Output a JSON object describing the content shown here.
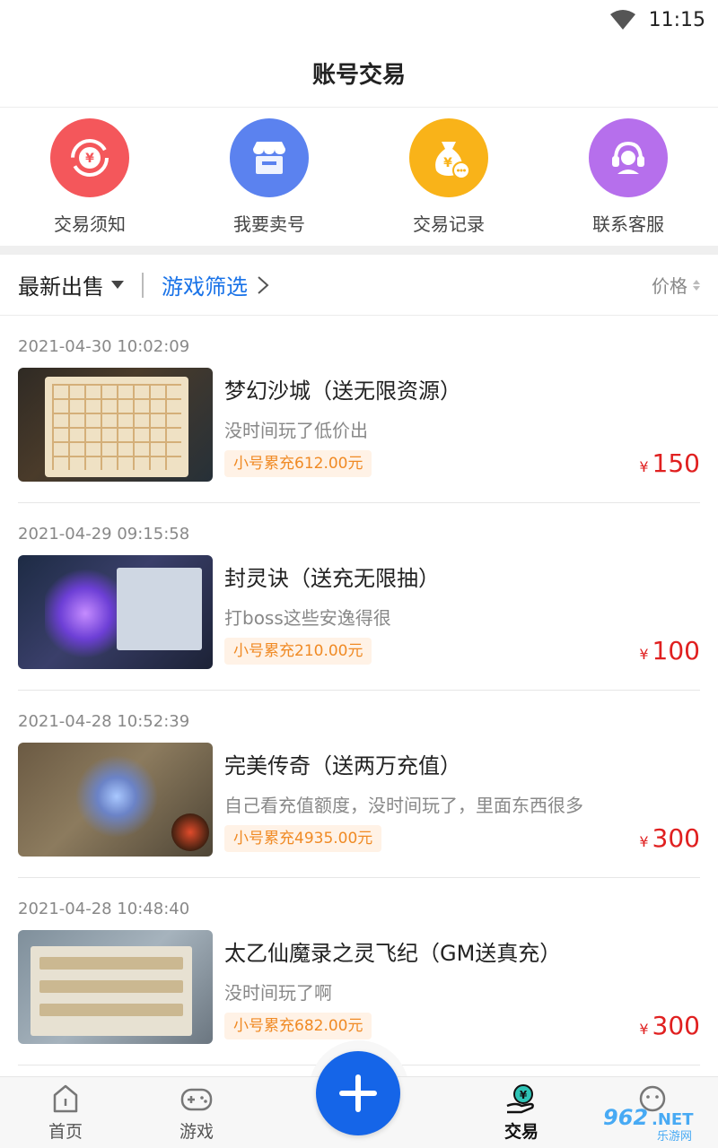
{
  "status_bar": {
    "time": "11:15"
  },
  "header": {
    "title": "账号交易"
  },
  "quick_actions": [
    {
      "label": "交易须知",
      "icon": "yuan-exchange-icon",
      "color": "#f4575b"
    },
    {
      "label": "我要卖号",
      "icon": "shop-icon",
      "color": "#5b82ef"
    },
    {
      "label": "交易记录",
      "icon": "money-bag-icon",
      "color": "#f9b319"
    },
    {
      "label": "联系客服",
      "icon": "headset-icon",
      "color": "#b66fec"
    }
  ],
  "filter_bar": {
    "sort_label": "最新出售",
    "game_filter": "游戏筛选",
    "price_label": "价格"
  },
  "listings": [
    {
      "date": "2021-04-30 10:02:09",
      "title": "梦幻沙城（送无限资源）",
      "desc": "没时间玩了低价出",
      "tag": "小号累充612.00元",
      "currency": "¥",
      "price": "150"
    },
    {
      "date": "2021-04-29 09:15:58",
      "title": "封灵诀（送充无限抽）",
      "desc": "打boss这些安逸得很",
      "tag": "小号累充210.00元",
      "currency": "¥",
      "price": "100"
    },
    {
      "date": "2021-04-28 10:52:39",
      "title": "完美传奇（送两万充值）",
      "desc": "自己看充值额度，没时间玩了，里面东西很多",
      "tag": "小号累充4935.00元",
      "currency": "¥",
      "price": "300"
    },
    {
      "date": "2021-04-28 10:48:40",
      "title": "太乙仙魔录之灵飞纪（GM送真充）",
      "desc": "没时间玩了啊",
      "tag": "小号累充682.00元",
      "currency": "¥",
      "price": "300"
    }
  ],
  "bottom_nav": {
    "home": "首页",
    "games": "游戏",
    "trade": "交易",
    "fab_icon": "plus-icon"
  },
  "accent_color": "#1565e8",
  "price_color": "#e02020"
}
